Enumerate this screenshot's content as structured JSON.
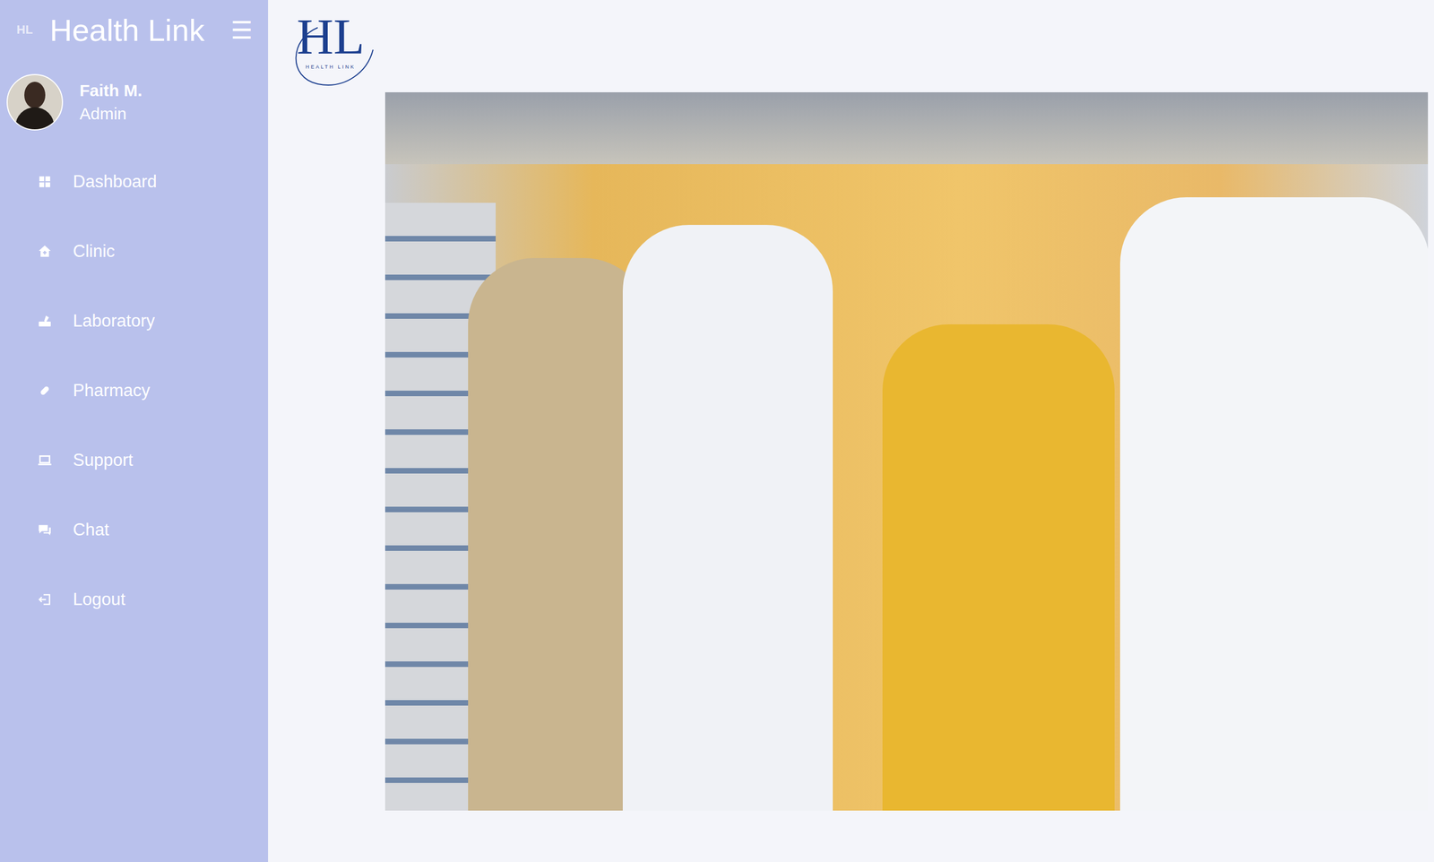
{
  "sidebar": {
    "logo_mark": "HL",
    "title": "Health Link",
    "menu_icon": "☰",
    "user": {
      "name": "Faith M.",
      "role": "Admin"
    },
    "items": [
      {
        "label": "Dashboard",
        "selected": false
      },
      {
        "label": "Clinic",
        "selected": false
      },
      {
        "label": "Laboratory",
        "selected": false
      },
      {
        "label": "Pharmacy",
        "selected": false
      },
      {
        "label": "Support",
        "selected": false
      },
      {
        "label": "Chat",
        "selected": false
      },
      {
        "label": "Logout",
        "selected": false
      }
    ]
  },
  "header": {
    "logo": {
      "initials": "HL",
      "tagline": "HEALTH LINK"
    }
  }
}
